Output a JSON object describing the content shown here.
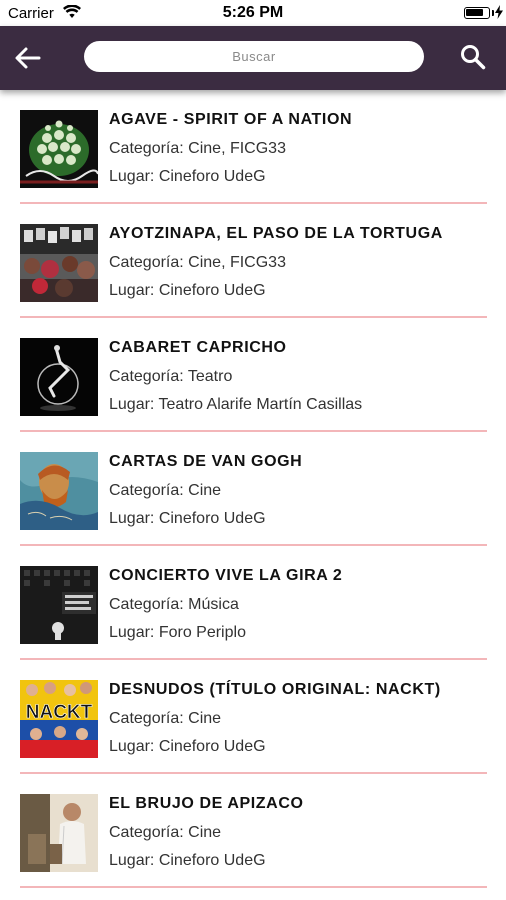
{
  "status_bar": {
    "carrier": "Carrier",
    "time": "5:26 PM",
    "battery_level": 0.8
  },
  "nav": {
    "search_placeholder": "Buscar",
    "back_icon": "arrow-left-icon",
    "search_icon": "magnifier-icon",
    "bar_color": "#3b2c41"
  },
  "events": [
    {
      "title": "AGAVE - SPIRIT OF A NATION",
      "category": "Categoría: Cine, FICG33",
      "place": "Lugar: Cineforo UdeG"
    },
    {
      "title": "AYOTZINAPA, EL PASO DE LA TORTUGA",
      "category": "Categoría: Cine, FICG33",
      "place": "Lugar: Cineforo UdeG"
    },
    {
      "title": "CABARET CAPRICHO",
      "category": "Categoría: Teatro",
      "place": "Lugar: Teatro Alarife Martín Casillas"
    },
    {
      "title": "CARTAS DE VAN GOGH",
      "category": "Categoría: Cine",
      "place": "Lugar: Cineforo UdeG"
    },
    {
      "title": "CONCIERTO VIVE LA GIRA 2",
      "category": "Categoría: Música",
      "place": "Lugar: Foro Periplo"
    },
    {
      "title": "DESNUDOS (TÍTULO ORIGINAL: NACKT)",
      "category": "Categoría: Cine",
      "place": "Lugar: Cineforo UdeG",
      "thumb_text": "NACKT"
    },
    {
      "title": "EL BRUJO DE APIZACO",
      "category": "Categoría: Cine",
      "place": "Lugar: Cineforo UdeG"
    }
  ],
  "colors": {
    "divider": "#f3b6b9",
    "nav": "#3b2c41"
  }
}
